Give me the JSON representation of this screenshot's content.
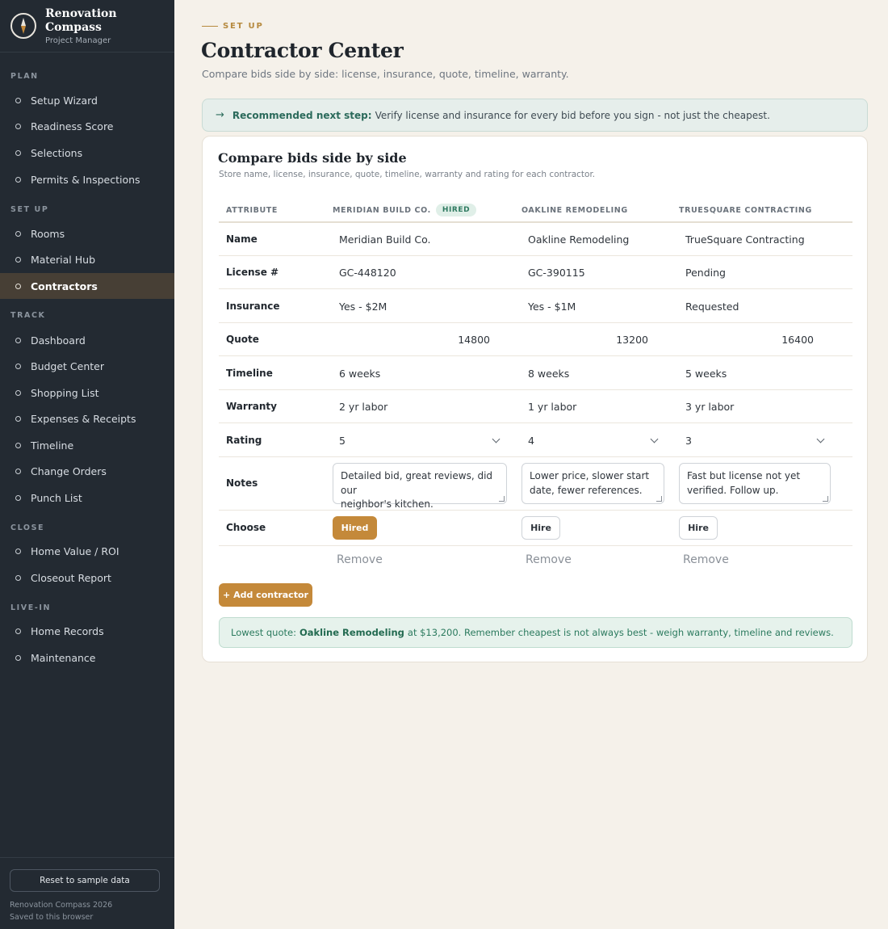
{
  "app": {
    "name": "Renovation Compass",
    "subtitle": "Project Manager"
  },
  "sidebar": {
    "sections": [
      {
        "label": "PLAN",
        "items": [
          "Setup Wizard",
          "Readiness Score",
          "Selections",
          "Permits & Inspections"
        ]
      },
      {
        "label": "SET UP",
        "items": [
          "Rooms",
          "Material Hub",
          "Contractors"
        ]
      },
      {
        "label": "TRACK",
        "items": [
          "Dashboard",
          "Budget Center",
          "Shopping List",
          "Expenses & Receipts",
          "Timeline",
          "Change Orders",
          "Punch List"
        ]
      },
      {
        "label": "CLOSE",
        "items": [
          "Home Value / ROI",
          "Closeout Report"
        ]
      },
      {
        "label": "LIVE-IN",
        "items": [
          "Home Records",
          "Maintenance"
        ]
      }
    ],
    "active_item": "Contractors",
    "reset_label": "Reset to sample data",
    "footer_line1": "Renovation Compass 2026",
    "footer_line2": "Saved to this browser"
  },
  "page": {
    "eyebrow": "SET UP",
    "title": "Contractor Center",
    "subtitle": "Compare bids side by side: license, insurance, quote, timeline, warranty."
  },
  "callout": {
    "strong": "Recommended next step:",
    "text": "Verify license and insurance for every bid before you sign - not just the cheapest."
  },
  "card": {
    "title": "Compare bids side by side",
    "subtitle": "Store name, license, insurance, quote, timeline, warranty and rating for each contractor."
  },
  "table": {
    "attribute_header": "ATTRIBUTE",
    "hired_badge": "HIRED",
    "contractors": [
      {
        "header": "MERIDIAN BUILD CO.",
        "name": "Meridian Build Co.",
        "license": "GC-448120",
        "insurance": "Yes - $2M",
        "quote": "14800",
        "timeline": "6 weeks",
        "warranty": "2 yr labor",
        "rating": "5",
        "notes": [
          "Detailed bid, great reviews, did our",
          "neighbor's kitchen."
        ],
        "choose": "Hired",
        "hired": true,
        "remove": "Remove"
      },
      {
        "header": "OAKLINE REMODELING",
        "name": "Oakline Remodeling",
        "license": "GC-390115",
        "insurance": "Yes - $1M",
        "quote": "13200",
        "timeline": "8 weeks",
        "warranty": "1 yr labor",
        "rating": "4",
        "notes": [
          "Lower price, slower start",
          "date, fewer references."
        ],
        "choose": "Hire",
        "hired": false,
        "remove": "Remove"
      },
      {
        "header": "TRUESQUARE CONTRACTING",
        "name": "TrueSquare Contracting",
        "license": "Pending",
        "insurance": "Requested",
        "quote": "16400",
        "timeline": "5 weeks",
        "warranty": "3 yr labor",
        "rating": "3",
        "notes": [
          "Fast but license not yet",
          "verified. Follow up."
        ],
        "choose": "Hire",
        "hired": false,
        "remove": "Remove"
      }
    ],
    "row_labels": {
      "name": "Name",
      "license": "License #",
      "insurance": "Insurance",
      "quote": "Quote",
      "timeline": "Timeline",
      "warranty": "Warranty",
      "rating": "Rating",
      "notes": "Notes",
      "choose": "Choose"
    }
  },
  "add_contractor_label": "+ Add contractor",
  "lowest_quote": {
    "prefix": "Lowest quote:",
    "contractor": "Oakline Remodeling",
    "suffix": "at $13,200. Remember cheapest is not always best - weigh warranty, timeline and reviews."
  },
  "colors": {
    "sidebar_bg": "#232a32",
    "accent": "#c4893a",
    "page_bg": "#f5f1ea",
    "success": "#2b7a5e"
  }
}
